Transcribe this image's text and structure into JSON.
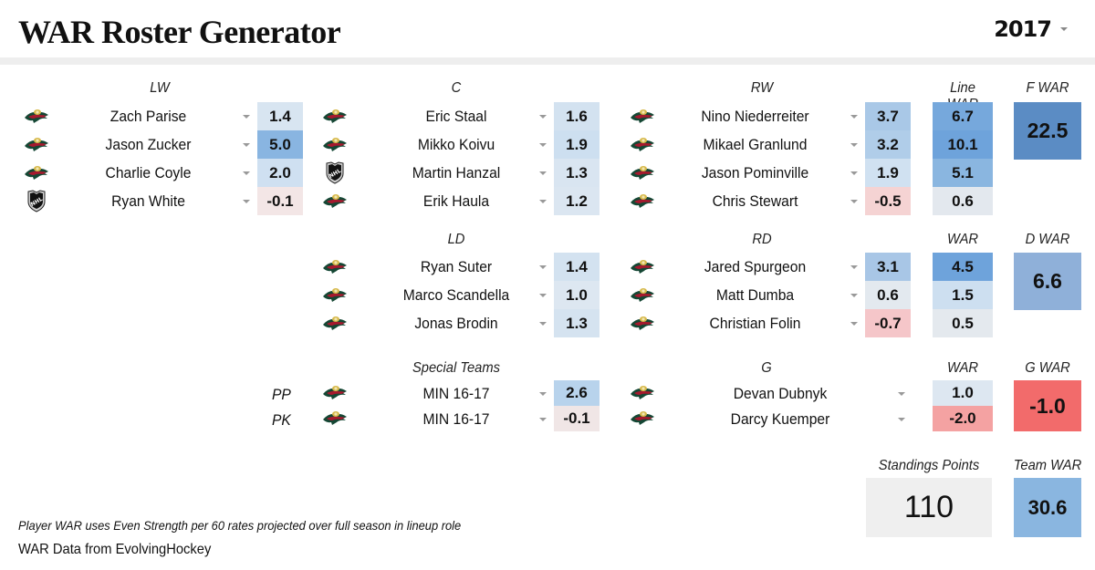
{
  "header": {
    "title": "WAR Roster Generator",
    "season": "2017"
  },
  "colors": {
    "wild_green": "#154734",
    "wild_red": "#a6192e",
    "wild_gold": "#ddcba4",
    "blue_strong": "#5b8cc4",
    "blue_mid": "#8eb6df",
    "red_strong": "#f26b6b"
  },
  "forwards": {
    "headers": {
      "lw": "LW",
      "c": "C",
      "rw": "RW",
      "line_war": "Line WAR",
      "f_war": "F WAR"
    },
    "lines": [
      {
        "lw": {
          "team": "MIN",
          "name": "Zach Parise",
          "war": "1.4",
          "color": "#d8e5f1"
        },
        "c": {
          "team": "MIN",
          "name": "Eric Staal",
          "war": "1.6",
          "color": "#d3e2f0"
        },
        "rw": {
          "team": "MIN",
          "name": "Nino Niederreiter",
          "war": "3.7",
          "color": "#a9c8e7"
        },
        "line_war": {
          "value": "6.7",
          "color": "#76a8dc"
        }
      },
      {
        "lw": {
          "team": "MIN",
          "name": "Jason Zucker",
          "war": "5.0",
          "color": "#89b5e1"
        },
        "c": {
          "team": "MIN",
          "name": "Mikko Koivu",
          "war": "1.9",
          "color": "#cddff0"
        },
        "rw": {
          "team": "MIN",
          "name": "Mikael Granlund",
          "war": "3.2",
          "color": "#b0cde9"
        },
        "line_war": {
          "value": "10.1",
          "color": "#6ea3db"
        }
      },
      {
        "lw": {
          "team": "MIN",
          "name": "Charlie Coyle",
          "war": "2.0",
          "color": "#cfe0f1"
        },
        "c": {
          "team": "NHL",
          "name": "Martin Hanzal",
          "war": "1.3",
          "color": "#d9e5f1"
        },
        "rw": {
          "team": "MIN",
          "name": "Jason Pominville",
          "war": "1.9",
          "color": "#d0e1f1"
        },
        "line_war": {
          "value": "5.1",
          "color": "#8ab6e0"
        }
      },
      {
        "lw": {
          "team": "NHL",
          "name": "Ryan White",
          "war": "-0.1",
          "color": "#f3e6e6"
        },
        "c": {
          "team": "MIN",
          "name": "Erik Haula",
          "war": "1.2",
          "color": "#dbe6f1"
        },
        "rw": {
          "team": "MIN",
          "name": "Chris Stewart",
          "war": "-0.5",
          "color": "#f5d3d3"
        },
        "line_war": {
          "value": "0.6",
          "color": "#e3e8ee"
        }
      }
    ],
    "total": {
      "value": "22.5",
      "color": "#5b8cc4"
    }
  },
  "defense": {
    "headers": {
      "ld": "LD",
      "rd": "RD",
      "war": "WAR",
      "d_war": "D WAR"
    },
    "pairs": [
      {
        "ld": {
          "team": "MIN",
          "name": "Ryan Suter",
          "war": "1.4",
          "color": "#d3e2f0"
        },
        "rd": {
          "team": "MIN",
          "name": "Jared Spurgeon",
          "war": "3.1",
          "color": "#a8c6e6"
        },
        "pair_war": {
          "value": "4.5",
          "color": "#6ea3db"
        }
      },
      {
        "ld": {
          "team": "MIN",
          "name": "Marco Scandella",
          "war": "1.0",
          "color": "#dde7f1"
        },
        "rd": {
          "team": "MIN",
          "name": "Matt Dumba",
          "war": "0.6",
          "color": "#e3e9ef"
        },
        "pair_war": {
          "value": "1.5",
          "color": "#cddff0"
        }
      },
      {
        "ld": {
          "team": "MIN",
          "name": "Jonas Brodin",
          "war": "1.3",
          "color": "#d5e3f0"
        },
        "rd": {
          "team": "MIN",
          "name": "Christian Folin",
          "war": "-0.7",
          "color": "#f5c6c9"
        },
        "pair_war": {
          "value": "0.5",
          "color": "#e4e9ee"
        }
      }
    ],
    "total": {
      "value": "6.6",
      "color": "#8fb0d9"
    }
  },
  "special_teams": {
    "header": "Special Teams",
    "units": [
      {
        "label": "PP",
        "team": "MIN",
        "name": "MIN 16-17",
        "war": "2.6",
        "color": "#b8d3ec"
      },
      {
        "label": "PK",
        "team": "MIN",
        "name": "MIN 16-17",
        "war": "-0.1",
        "color": "#f0e6e6"
      }
    ]
  },
  "goalies": {
    "headers": {
      "g": "G",
      "war": "WAR",
      "g_war": "G WAR"
    },
    "players": [
      {
        "team": "MIN",
        "name": "Devan Dubnyk",
        "war": "1.0",
        "color": "#dde7f1"
      },
      {
        "team": "MIN",
        "name": "Darcy Kuemper",
        "war": "-2.0",
        "color": "#f4a2a2"
      }
    ],
    "total": {
      "value": "-1.0",
      "color": "#f26b6b"
    }
  },
  "summary": {
    "standings_label": "Standings Points",
    "standings_value": "110",
    "team_war_label": "Team WAR",
    "team_war_value": "30.6",
    "team_war_color": "#8ab6e0"
  },
  "footer": {
    "note": "Player WAR uses Even Strength per 60 rates projected over full season in lineup role",
    "credit": "WAR Data from EvolvingHockey"
  }
}
